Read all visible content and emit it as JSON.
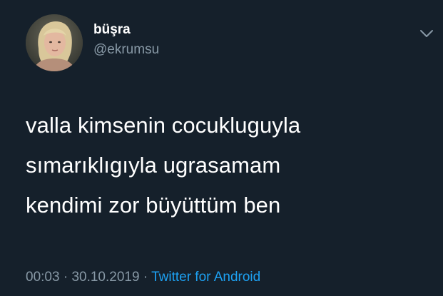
{
  "tweet": {
    "author": {
      "display_name": "büşra",
      "handle": "@ekrumsu"
    },
    "text": "valla kimsenin cocukluguyla\nsımarıklıgıyla ugrasamam\nkendimi zor büyüttüm ben",
    "time": "00:03",
    "separator": " · ",
    "date": "30.10.2019",
    "source": "Twitter for Android"
  },
  "icons": {
    "menu": "chevron-down-icon"
  },
  "colors": {
    "background": "#15202b",
    "primary_text": "#ffffff",
    "secondary_text": "#8899a6",
    "link": "#1da1f2"
  }
}
